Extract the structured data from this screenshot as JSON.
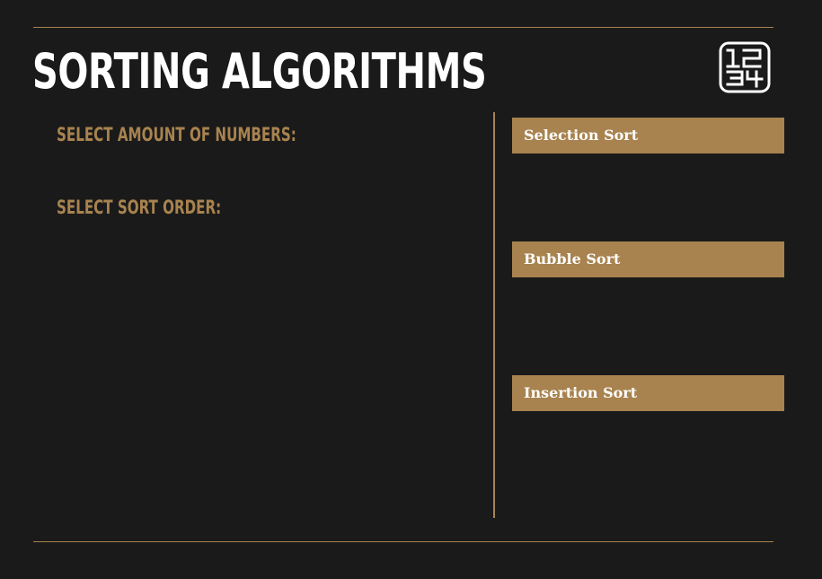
{
  "header": {
    "title": "SORTING ALGORITHMS",
    "logo_icon": "numbers-1234-icon"
  },
  "controls": {
    "amount_label": "SELECT AMOUNT OF NUMBERS:",
    "order_label": "SELECT SORT ORDER:"
  },
  "algorithms": [
    {
      "label": "Selection Sort"
    },
    {
      "label": "Bubble Sort"
    },
    {
      "label": "Insertion Sort"
    }
  ],
  "colors": {
    "background": "#1a1a1a",
    "accent": "#a8834f",
    "text": "#ffffff"
  }
}
